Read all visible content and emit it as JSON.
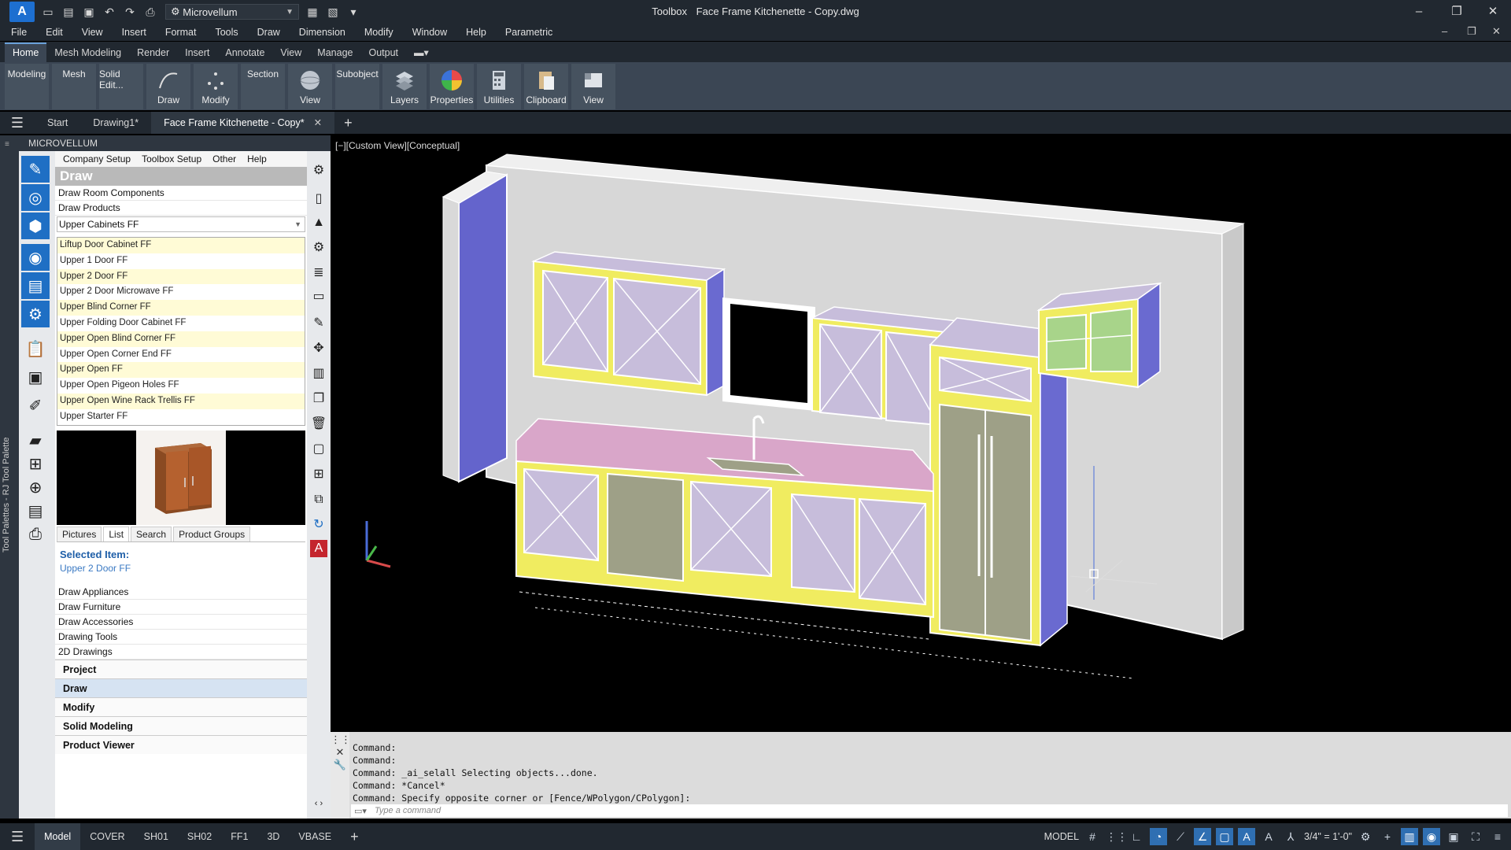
{
  "titlebar": {
    "app_logo": "A",
    "workspace": "Microvellum",
    "title_app": "Toolbox",
    "title_doc": "Face Frame Kitchenette - Copy.dwg"
  },
  "menubar": [
    "File",
    "Edit",
    "View",
    "Insert",
    "Format",
    "Tools",
    "Draw",
    "Dimension",
    "Modify",
    "Window",
    "Help",
    "Parametric"
  ],
  "ribbon_tabs": [
    "Home",
    "Mesh Modeling",
    "Render",
    "Insert",
    "Annotate",
    "View",
    "Manage",
    "Output"
  ],
  "ribbon_active_tab": "Home",
  "ribbon_buttons": [
    {
      "label": "Modeling",
      "icon": ""
    },
    {
      "label": "Mesh",
      "icon": ""
    },
    {
      "label": "Solid Edit...",
      "icon": ""
    },
    {
      "label": "Draw",
      "icon": "draw-icon"
    },
    {
      "label": "Modify",
      "icon": "modify-icon"
    },
    {
      "label": "Section",
      "icon": ""
    },
    {
      "label": "View",
      "icon": "sphere-icon"
    },
    {
      "label": "Subobject",
      "icon": ""
    },
    {
      "label": "Layers",
      "icon": "layers-icon"
    },
    {
      "label": "Properties",
      "icon": "color-wheel-icon"
    },
    {
      "label": "Utilities",
      "icon": "calculator-icon"
    },
    {
      "label": "Clipboard",
      "icon": "clipboard-icon"
    },
    {
      "label": "View",
      "icon": "view-icon"
    }
  ],
  "doc_tabs": [
    {
      "label": "Start"
    },
    {
      "label": "Drawing1*"
    },
    {
      "label": "Face Frame Kitchenette - Copy*",
      "active": true
    }
  ],
  "palette": {
    "vertical_label": "Tool Palettes - RJ Tool Palette",
    "header": "MICROVELLUM",
    "menu": [
      "Company Setup",
      "Toolbox Setup",
      "Other",
      "Help"
    ],
    "section_title": "Draw",
    "top_rows": [
      "Draw Room Components",
      "Draw Products"
    ],
    "dropdown": "Upper Cabinets FF",
    "products": [
      "Liftup Door Cabinet FF",
      "Upper 1 Door FF",
      "Upper 2 Door FF",
      "Upper 2 Door Microwave FF",
      "Upper Blind Corner FF",
      "Upper Folding Door Cabinet FF",
      "Upper Open Blind Corner FF",
      "Upper Open Corner End FF",
      "Upper Open FF",
      "Upper Open Pigeon Holes FF",
      "Upper Open Wine Rack Trellis FF",
      "Upper Starter FF"
    ],
    "tabs": [
      "Pictures",
      "List",
      "Search",
      "Product Groups"
    ],
    "active_tab": "List",
    "selected_label": "Selected Item:",
    "selected_value": "Upper 2 Door FF",
    "draw_rows": [
      "Draw Appliances",
      "Draw Furniture",
      "Draw Accessories",
      "Drawing Tools",
      "2D Drawings"
    ],
    "sections": [
      "Project",
      "Draw",
      "Modify",
      "Solid Modeling",
      "Product Viewer"
    ],
    "active_section": "Draw"
  },
  "viewport": {
    "label": "[−][Custom View][Conceptual]"
  },
  "command": {
    "history": [
      "Command:",
      "Command:",
      "Command: _ai_selall Selecting objects...done.",
      "Command: *Cancel*",
      "Command: Specify opposite corner or [Fence/WPolygon/CPolygon]:"
    ],
    "placeholder": "Type a command"
  },
  "status": {
    "layout_tabs": [
      "Model",
      "COVER",
      "SH01",
      "SH02",
      "FF1",
      "3D",
      "VBASE"
    ],
    "active_layout": "Model",
    "model_label": "MODEL",
    "scale": "3/4\" = 1'-0\""
  },
  "colors": {
    "app_dark": "#212830",
    "ribbon": "#3b4654",
    "accent_blue": "#1f6fc4",
    "cabinet_frame": "#f2ef6a",
    "cabinet_panel": "#c7bddb",
    "countertop": "#d9a6c9",
    "wall": "#d9d9d9",
    "end_panel": "#6a6ad0",
    "appliance": "#9ea087"
  }
}
